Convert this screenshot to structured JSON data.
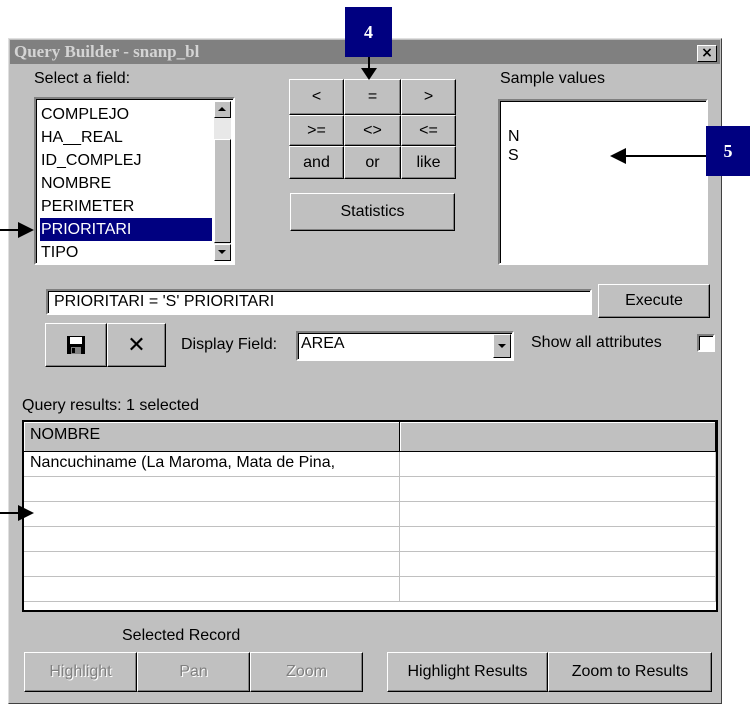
{
  "window": {
    "title": "Query Builder - snanp_bl",
    "close_glyph": "×"
  },
  "fields": {
    "label": "Select a field:",
    "items": [
      "COMPLEJO",
      "HA__REAL",
      "ID_COMPLEJ",
      "NOMBRE",
      "PERIMETER",
      "PRIORITARI",
      "TIPO"
    ],
    "selected": "PRIORITARI"
  },
  "operators": [
    [
      "<",
      "=",
      ">"
    ],
    [
      ">=",
      "<>",
      "<="
    ],
    [
      "and",
      "or",
      "like"
    ]
  ],
  "statistics_label": "Statistics",
  "sample_values": {
    "label": "Sample values",
    "items": [
      "N",
      "S"
    ]
  },
  "query": {
    "expression": "PRIORITARI = 'S' PRIORITARI",
    "execute_label": "Execute"
  },
  "toolbar": {
    "save_icon": "save-icon",
    "clear_icon": "clear-icon",
    "clear_glyph": "✕"
  },
  "display_field": {
    "label": "Display Field:",
    "value": "AREA"
  },
  "show_all": {
    "label": "Show all attributes",
    "checked": false
  },
  "results": {
    "label": "Query results: 1 selected",
    "columns": [
      "NOMBRE",
      ""
    ],
    "rows": [
      [
        "Nancuchiname (La Maroma, Mata de Pina,",
        ""
      ]
    ]
  },
  "selected_record": {
    "label": "Selected Record",
    "highlight": "Highlight",
    "pan": "Pan",
    "zoom": "Zoom",
    "highlight_results": "Highlight Results",
    "zoom_to_results": "Zoom to Results"
  },
  "callouts": {
    "four": "4",
    "five": "5"
  },
  "colors": {
    "title_bar": "#808080",
    "selection": "#000080",
    "callout": "#000080",
    "face": "#c0c0c0"
  }
}
